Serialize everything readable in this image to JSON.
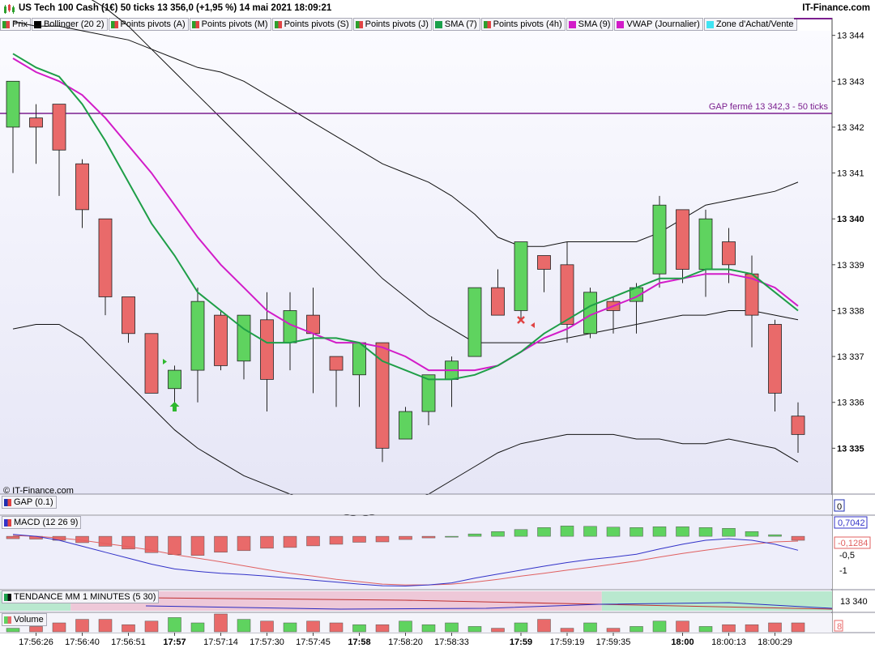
{
  "header": {
    "title": "US Tech 100 Cash (1€) 50 ticks 13 356,0 (+1,95 %) 14 mai 2021 18:09:21",
    "brand": "IT-Finance.com"
  },
  "legend": [
    {
      "label": "Prix",
      "color": "pair"
    },
    {
      "label": "Bollinger (20 2)",
      "color": "#000000"
    },
    {
      "label": "Points pivots (A)",
      "color": "pair"
    },
    {
      "label": "Points pivots (M)",
      "color": "pair"
    },
    {
      "label": "Points pivots (S)",
      "color": "pair"
    },
    {
      "label": "Points pivots (J)",
      "color": "pair"
    },
    {
      "label": "SMA (7)",
      "color": "#1aa04a"
    },
    {
      "label": "Points pivots (4h)",
      "color": "pair"
    },
    {
      "label": "SMA (9)",
      "color": "#d21cc8"
    },
    {
      "label": "VWAP (Journalier)",
      "color": "#d21cc8"
    },
    {
      "label": "Zone d'Achat/Vente",
      "color": "#3fe3f2"
    }
  ],
  "colors": {
    "up": "#5fd35f",
    "down": "#e96a6a",
    "sma7": "#1e9e47",
    "sma9": "#d21cc8",
    "gap": "#7b1f8f",
    "macd": "#3232c8",
    "signal": "#e06060"
  },
  "price_chart": {
    "watermark": "© IT-Finance.com",
    "gap_label": "GAP fermé 13 342,3 - 50 ticks",
    "gap_level": 13342.3
  },
  "chart_data": {
    "type": "candlestick",
    "ylim": [
      13334.0,
      13344.1
    ],
    "y_ticks": [
      13335,
      13336,
      13337,
      13338,
      13339,
      13340,
      13341,
      13342,
      13343,
      13344
    ],
    "y_tick_labels": [
      "13 335",
      "13 336",
      "13 337",
      "13 338",
      "13 339",
      "13 340",
      "13 341",
      "13 342",
      "13 343",
      "13 344"
    ],
    "bold_ticks": [
      "13 335",
      "13 340"
    ],
    "candles": [
      {
        "o": 13342.0,
        "h": 13343.0,
        "l": 13341.0,
        "c": 13343.0
      },
      {
        "o": 13342.2,
        "h": 13342.5,
        "l": 13341.2,
        "c": 13342.0
      },
      {
        "o": 13342.5,
        "h": 13342.5,
        "l": 13340.5,
        "c": 13341.5
      },
      {
        "o": 13341.2,
        "h": 13341.3,
        "l": 13339.8,
        "c": 13340.2
      },
      {
        "o": 13340.0,
        "h": 13340.0,
        "l": 13337.9,
        "c": 13338.3
      },
      {
        "o": 13338.3,
        "h": 13338.3,
        "l": 13337.3,
        "c": 13337.5
      },
      {
        "o": 13337.5,
        "h": 13337.5,
        "l": 13336.2,
        "c": 13336.2
      },
      {
        "o": 13336.3,
        "h": 13336.8,
        "l": 13335.8,
        "c": 13336.7
      },
      {
        "o": 13336.7,
        "h": 13338.5,
        "l": 13336.0,
        "c": 13338.2
      },
      {
        "o": 13337.9,
        "h": 13338.0,
        "l": 13336.7,
        "c": 13336.8
      },
      {
        "o": 13336.9,
        "h": 13337.9,
        "l": 13336.5,
        "c": 13337.9
      },
      {
        "o": 13337.8,
        "h": 13338.4,
        "l": 13335.8,
        "c": 13336.5
      },
      {
        "o": 13337.3,
        "h": 13338.4,
        "l": 13336.7,
        "c": 13338.0
      },
      {
        "o": 13337.9,
        "h": 13338.5,
        "l": 13336.2,
        "c": 13337.5
      },
      {
        "o": 13337.0,
        "h": 13337.0,
        "l": 13335.9,
        "c": 13336.7
      },
      {
        "o": 13336.6,
        "h": 13337.3,
        "l": 13335.9,
        "c": 13337.3
      },
      {
        "o": 13337.3,
        "h": 13337.3,
        "l": 13334.7,
        "c": 13335.0
      },
      {
        "o": 13335.2,
        "h": 13335.9,
        "l": 13335.2,
        "c": 13335.8
      },
      {
        "o": 13335.8,
        "h": 13336.6,
        "l": 13335.5,
        "c": 13336.6
      },
      {
        "o": 13336.5,
        "h": 13337.0,
        "l": 13335.9,
        "c": 13336.9
      },
      {
        "o": 13337.0,
        "h": 13338.5,
        "l": 13337.0,
        "c": 13338.5
      },
      {
        "o": 13338.5,
        "h": 13338.9,
        "l": 13337.9,
        "c": 13337.9
      },
      {
        "o": 13338.0,
        "h": 13339.5,
        "l": 13337.8,
        "c": 13339.5
      },
      {
        "o": 13339.2,
        "h": 13339.2,
        "l": 13338.4,
        "c": 13338.9
      },
      {
        "o": 13339.0,
        "h": 13339.5,
        "l": 13337.3,
        "c": 13337.7
      },
      {
        "o": 13337.5,
        "h": 13338.5,
        "l": 13337.4,
        "c": 13338.4
      },
      {
        "o": 13338.2,
        "h": 13338.3,
        "l": 13337.5,
        "c": 13338.0
      },
      {
        "o": 13338.2,
        "h": 13338.6,
        "l": 13337.5,
        "c": 13338.5
      },
      {
        "o": 13338.8,
        "h": 13340.5,
        "l": 13338.5,
        "c": 13340.3
      },
      {
        "o": 13340.2,
        "h": 13340.2,
        "l": 13338.6,
        "c": 13338.9
      },
      {
        "o": 13338.9,
        "h": 13340.2,
        "l": 13338.3,
        "c": 13340.0
      },
      {
        "o": 13339.5,
        "h": 13339.8,
        "l": 13338.6,
        "c": 13339.0
      },
      {
        "o": 13338.8,
        "h": 13339.2,
        "l": 13337.2,
        "c": 13337.9
      },
      {
        "o": 13337.7,
        "h": 13337.8,
        "l": 13335.8,
        "c": 13336.2
      },
      {
        "o": 13335.7,
        "h": 13336.0,
        "l": 13334.9,
        "c": 13335.3
      }
    ],
    "sma7": [
      13343.6,
      13343.3,
      13343.1,
      13342.5,
      13341.7,
      13340.8,
      13339.9,
      13339.2,
      13338.4,
      13338.0,
      13337.6,
      13337.3,
      13337.3,
      13337.4,
      13337.4,
      13337.3,
      13336.9,
      13336.7,
      13336.5,
      13336.5,
      13336.6,
      13336.8,
      13337.1,
      13337.5,
      13337.8,
      13338.1,
      13338.3,
      13338.5,
      13338.7,
      13338.7,
      13338.9,
      13338.9,
      13338.8,
      13338.4,
      13338.0
    ],
    "sma9": [
      13343.5,
      13343.2,
      13343.0,
      13342.7,
      13342.2,
      13341.6,
      13341.0,
      13340.3,
      13339.6,
      13339.0,
      13338.5,
      13338.0,
      13337.7,
      13337.5,
      13337.3,
      13337.3,
      13337.2,
      13337.0,
      13336.7,
      13336.7,
      13336.7,
      13336.8,
      13337.1,
      13337.4,
      13337.6,
      13337.9,
      13338.1,
      13338.3,
      13338.6,
      13338.7,
      13338.8,
      13338.8,
      13338.7,
      13338.5,
      13338.1
    ],
    "boll_upper": [
      13344.3,
      13344.2,
      13344.2,
      13344.1,
      13344.0,
      13343.9,
      13343.7,
      13343.5,
      13343.3,
      13343.2,
      13343.0,
      13342.7,
      13342.4,
      13342.1,
      13341.8,
      13341.5,
      13341.2,
      13341.0,
      13340.8,
      13340.5,
      13340.1,
      13339.6,
      13339.4,
      13339.4,
      13339.5,
      13339.5,
      13339.5,
      13339.5,
      13339.7,
      13340.0,
      13340.3,
      13340.4,
      13340.5,
      13340.6,
      13340.8
    ],
    "boll_mid": [
      13345.4,
      13345.3,
      13345.1,
      13344.9,
      13344.6,
      13344.2,
      13343.7,
      13343.2,
      13342.7,
      13342.2,
      13341.7,
      13341.2,
      13340.7,
      13340.2,
      13339.7,
      13339.2,
      13338.7,
      13338.3,
      13337.9,
      13337.6,
      13337.3,
      13337.3,
      13337.3,
      13337.3,
      13337.4,
      13337.5,
      13337.6,
      13337.7,
      13337.8,
      13337.9,
      13337.9,
      13338.0,
      13338.0,
      13337.9,
      13337.8
    ],
    "boll_lower": [
      13337.6,
      13337.7,
      13337.7,
      13337.4,
      13336.9,
      13336.4,
      13335.9,
      13335.4,
      13335.0,
      13334.7,
      13334.4,
      13334.2,
      13334.0,
      13333.8,
      13333.6,
      13333.5,
      13333.6,
      13333.8,
      13334.0,
      13334.3,
      13334.6,
      13334.9,
      13335.1,
      13335.2,
      13335.3,
      13335.3,
      13335.3,
      13335.2,
      13335.2,
      13335.1,
      13335.1,
      13335.2,
      13335.1,
      13335.0,
      13334.7
    ],
    "x_ticks": [
      {
        "label": "17:56:26",
        "i": 1,
        "bold": false
      },
      {
        "label": "17:56:40",
        "i": 3,
        "bold": false
      },
      {
        "label": "17:56:51",
        "i": 5,
        "bold": false
      },
      {
        "label": "17:57",
        "i": 7,
        "bold": true
      },
      {
        "label": "17:57:14",
        "i": 9,
        "bold": false
      },
      {
        "label": "17:57:30",
        "i": 11,
        "bold": false
      },
      {
        "label": "17:57:45",
        "i": 13,
        "bold": false
      },
      {
        "label": "17:58",
        "i": 15,
        "bold": true
      },
      {
        "label": "17:58:20",
        "i": 17,
        "bold": false
      },
      {
        "label": "17:58:33",
        "i": 19,
        "bold": false
      },
      {
        "label": "17:59",
        "i": 22,
        "bold": true
      },
      {
        "label": "17:59:19",
        "i": 24,
        "bold": false
      },
      {
        "label": "17:59:35",
        "i": 26,
        "bold": false
      },
      {
        "label": "18:00",
        "i": 29,
        "bold": true
      },
      {
        "label": "18:00:13",
        "i": 31,
        "bold": false
      },
      {
        "label": "18:00:29",
        "i": 33,
        "bold": false
      }
    ]
  },
  "gap_panel": {
    "label": "GAP (0.1)",
    "axis_label": "0",
    "color": "#1f2fb0"
  },
  "macd_panel": {
    "label": "MACD (12 26 9)",
    "value_label": "0,7042",
    "signal_label": "-0,1284",
    "tick_labels": [
      "-0,5",
      "-1"
    ],
    "ylim": [
      -1.3,
      0.45
    ],
    "hist": [
      -0.06,
      -0.07,
      -0.1,
      -0.16,
      -0.25,
      -0.32,
      -0.41,
      -0.46,
      -0.48,
      -0.4,
      -0.36,
      -0.3,
      -0.28,
      -0.24,
      -0.2,
      -0.15,
      -0.14,
      -0.08,
      -0.04,
      0.0,
      0.06,
      0.12,
      0.17,
      0.22,
      0.26,
      0.25,
      0.23,
      0.22,
      0.24,
      0.24,
      0.22,
      0.2,
      0.12,
      0.04,
      -0.1
    ],
    "macd": [
      0.05,
      0.0,
      -0.1,
      -0.25,
      -0.4,
      -0.55,
      -0.7,
      -0.82,
      -0.88,
      -0.93,
      -0.96,
      -1.0,
      -1.05,
      -1.1,
      -1.15,
      -1.2,
      -1.24,
      -1.25,
      -1.22,
      -1.17,
      -1.05,
      -0.95,
      -0.85,
      -0.75,
      -0.66,
      -0.58,
      -0.52,
      -0.45,
      -0.32,
      -0.2,
      -0.1,
      -0.06,
      -0.1,
      -0.2,
      -0.35
    ],
    "signal": [
      0.02,
      0.0,
      -0.04,
      -0.1,
      -0.18,
      -0.26,
      -0.35,
      -0.46,
      -0.55,
      -0.64,
      -0.74,
      -0.84,
      -0.93,
      -1.0,
      -1.08,
      -1.14,
      -1.2,
      -1.22,
      -1.22,
      -1.2,
      -1.15,
      -1.08,
      -1.0,
      -0.93,
      -0.85,
      -0.78,
      -0.7,
      -0.62,
      -0.52,
      -0.43,
      -0.35,
      -0.27,
      -0.2,
      -0.14,
      -0.12
    ]
  },
  "trend_panel": {
    "label": "TENDANCE MM 1 MINUTES (5 30)",
    "axis_label": "13 340",
    "zones": [
      {
        "start": 0,
        "end": 2,
        "color": "#b9e8cf"
      },
      {
        "start": 3,
        "end": 25,
        "color": "#eec8d8"
      },
      {
        "start": 26,
        "end": 34,
        "color": "#b9e8cf"
      }
    ]
  },
  "volume_panel": {
    "label": "Volume",
    "axis_label": "8",
    "values": [
      2,
      3,
      5,
      7,
      7,
      4,
      6,
      8,
      5,
      10,
      7,
      6,
      5,
      6,
      5,
      4,
      4,
      6,
      4,
      5,
      3,
      2,
      5,
      7,
      2,
      5,
      2,
      3,
      6,
      6,
      3,
      4,
      4,
      5,
      5
    ]
  }
}
